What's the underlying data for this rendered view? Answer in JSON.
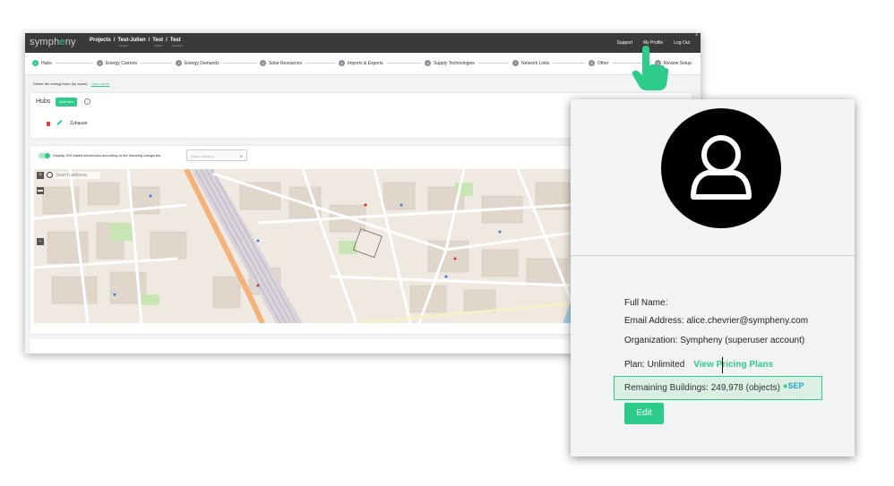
{
  "app": {
    "logo": {
      "prefix": "symph",
      "accent": "e",
      "suffix": "ny"
    },
    "breadcrumbs": [
      {
        "label": "Projects",
        "sub": ""
      },
      {
        "label": "/",
        "sub": ""
      },
      {
        "label": "Test-Julien",
        "sub": "Project"
      },
      {
        "label": "/",
        "sub": ""
      },
      {
        "label": "Test",
        "sub": "Variant"
      },
      {
        "label": "/",
        "sub": ""
      },
      {
        "label": "Test",
        "sub": "Scenario"
      }
    ],
    "nav": {
      "support": "Support",
      "my_profile": "My Profile",
      "logout": "Log Out"
    },
    "steps": [
      {
        "num": "1",
        "label": "Hubs"
      },
      {
        "num": "2",
        "label": "Energy Carriers"
      },
      {
        "num": "3",
        "label": "Energy Demands"
      },
      {
        "num": "4",
        "label": "Solar Resources"
      },
      {
        "num": "5",
        "label": "Imports & Exports"
      },
      {
        "num": "6",
        "label": "Supply Technologies"
      },
      {
        "num": "7",
        "label": "Network Links"
      },
      {
        "num": "8",
        "label": "Other"
      },
      {
        "num": "9",
        "label": "Review Setup"
      }
    ],
    "define_text": "Define the energy hubs (by name).",
    "learn_more": "Learn more",
    "hubs": {
      "title": "Hubs",
      "add_new": "Add New",
      "items": [
        "Zuhause"
      ]
    },
    "gis": {
      "label": "Display GIS based information according to the following categories:",
      "data_category_placeholder": "Data Category"
    },
    "map": {
      "search_placeholder": "Search address",
      "zoom_in": "+",
      "zoom_out": "−"
    }
  },
  "profile": {
    "full_name_label": "Full Name:",
    "full_name_value": "",
    "email": "Email Address: alice.chevrier@sympheny.com",
    "organization": "Organization: Sympheny (superuser account)",
    "plan": "Plan: Unlimited",
    "pricing_link": "View Pricing Plans",
    "remaining": "Remaining Buildings: 249,978 (objects)",
    "sep_logo": "SEP",
    "edit": "Edit"
  },
  "colors": {
    "accent": "#2ecc8a",
    "topbar": "#3a3a3a",
    "danger": "#e53935"
  }
}
